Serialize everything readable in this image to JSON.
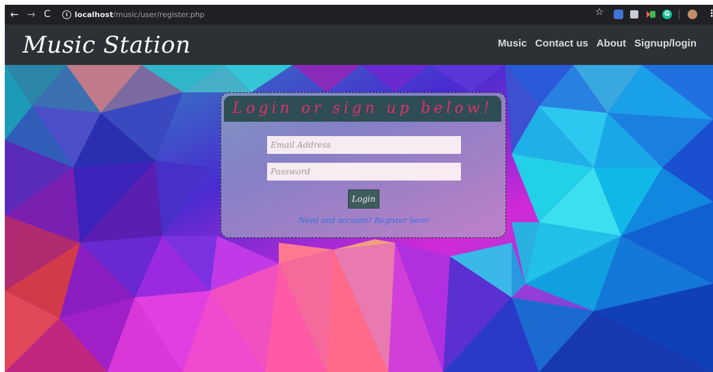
{
  "browser": {
    "back": "←",
    "forward": "→",
    "reload": "C",
    "url_host": "localhost",
    "url_path": "/music/user/register.php",
    "star": "☆",
    "menu": "⋮",
    "ext_grammarly": "G",
    "icons": [
      "back-arrow-icon",
      "forward-arrow-icon",
      "reload-icon",
      "info-icon",
      "star-icon",
      "extension-icon",
      "avatar",
      "menu-icon"
    ]
  },
  "navbar": {
    "brand": "Music Station",
    "links": [
      "Music",
      "Contact us",
      "About",
      "Signup/login"
    ]
  },
  "login": {
    "title": "Login or sign up below!",
    "email_placeholder": "Email Address",
    "password_placeholder": "Password",
    "button_label": "Login",
    "register_text": "Need and account? Register here!"
  },
  "colors": {
    "navbar_bg": "#2d3136",
    "card_header_bg": "#2e4e53",
    "title_color": "#e0306f",
    "button_bg": "#3f5c5c",
    "link_color": "#2f6fe0"
  }
}
